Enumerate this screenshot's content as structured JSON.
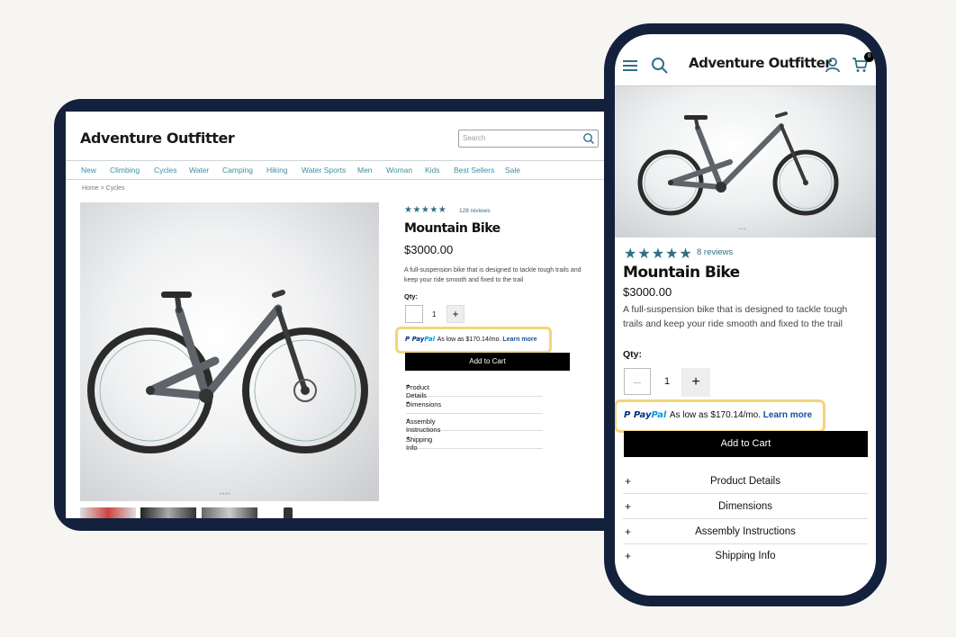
{
  "brand": "Adventure Outfitter",
  "desktop": {
    "search_placeholder": "Search",
    "nav": [
      "New",
      "Climbing",
      "Cycles",
      "Water",
      "Camping",
      "Hiking",
      "Water Sports",
      "Men",
      "Woman",
      "Kids",
      "Best Sellers",
      "Sale"
    ],
    "breadcrumb": "Home > Cycles",
    "carousel_dots": "••••",
    "reviews": "128 reviews",
    "qty_label": "Qty:",
    "qty_value": "1"
  },
  "mobile": {
    "cart_count": "0",
    "carousel_dots": "•••",
    "reviews": "8 reviews",
    "qty_label": "Qty:",
    "qty_value": "1"
  },
  "product": {
    "title": "Mountain Bike",
    "price": "$3000.00",
    "description": "A full-suspension bike that is designed to tackle tough trails and keep your ride smooth and fixed to the trail",
    "rating": 4.5,
    "stars": "★★★★★",
    "add_to_cart": "Add to Cart",
    "accordion": [
      "Product Details",
      "Dimensions",
      "Assembly Instructions",
      "Shipping Info"
    ]
  },
  "paypal": {
    "logo_pay": "Pay",
    "logo_pal": "Pal",
    "message": "As low as $170.14/mo.",
    "learn_more": "Learn more"
  },
  "colors": {
    "accent": "#2f6f86",
    "highlight": "#f2d67a",
    "frame": "#14213d"
  }
}
